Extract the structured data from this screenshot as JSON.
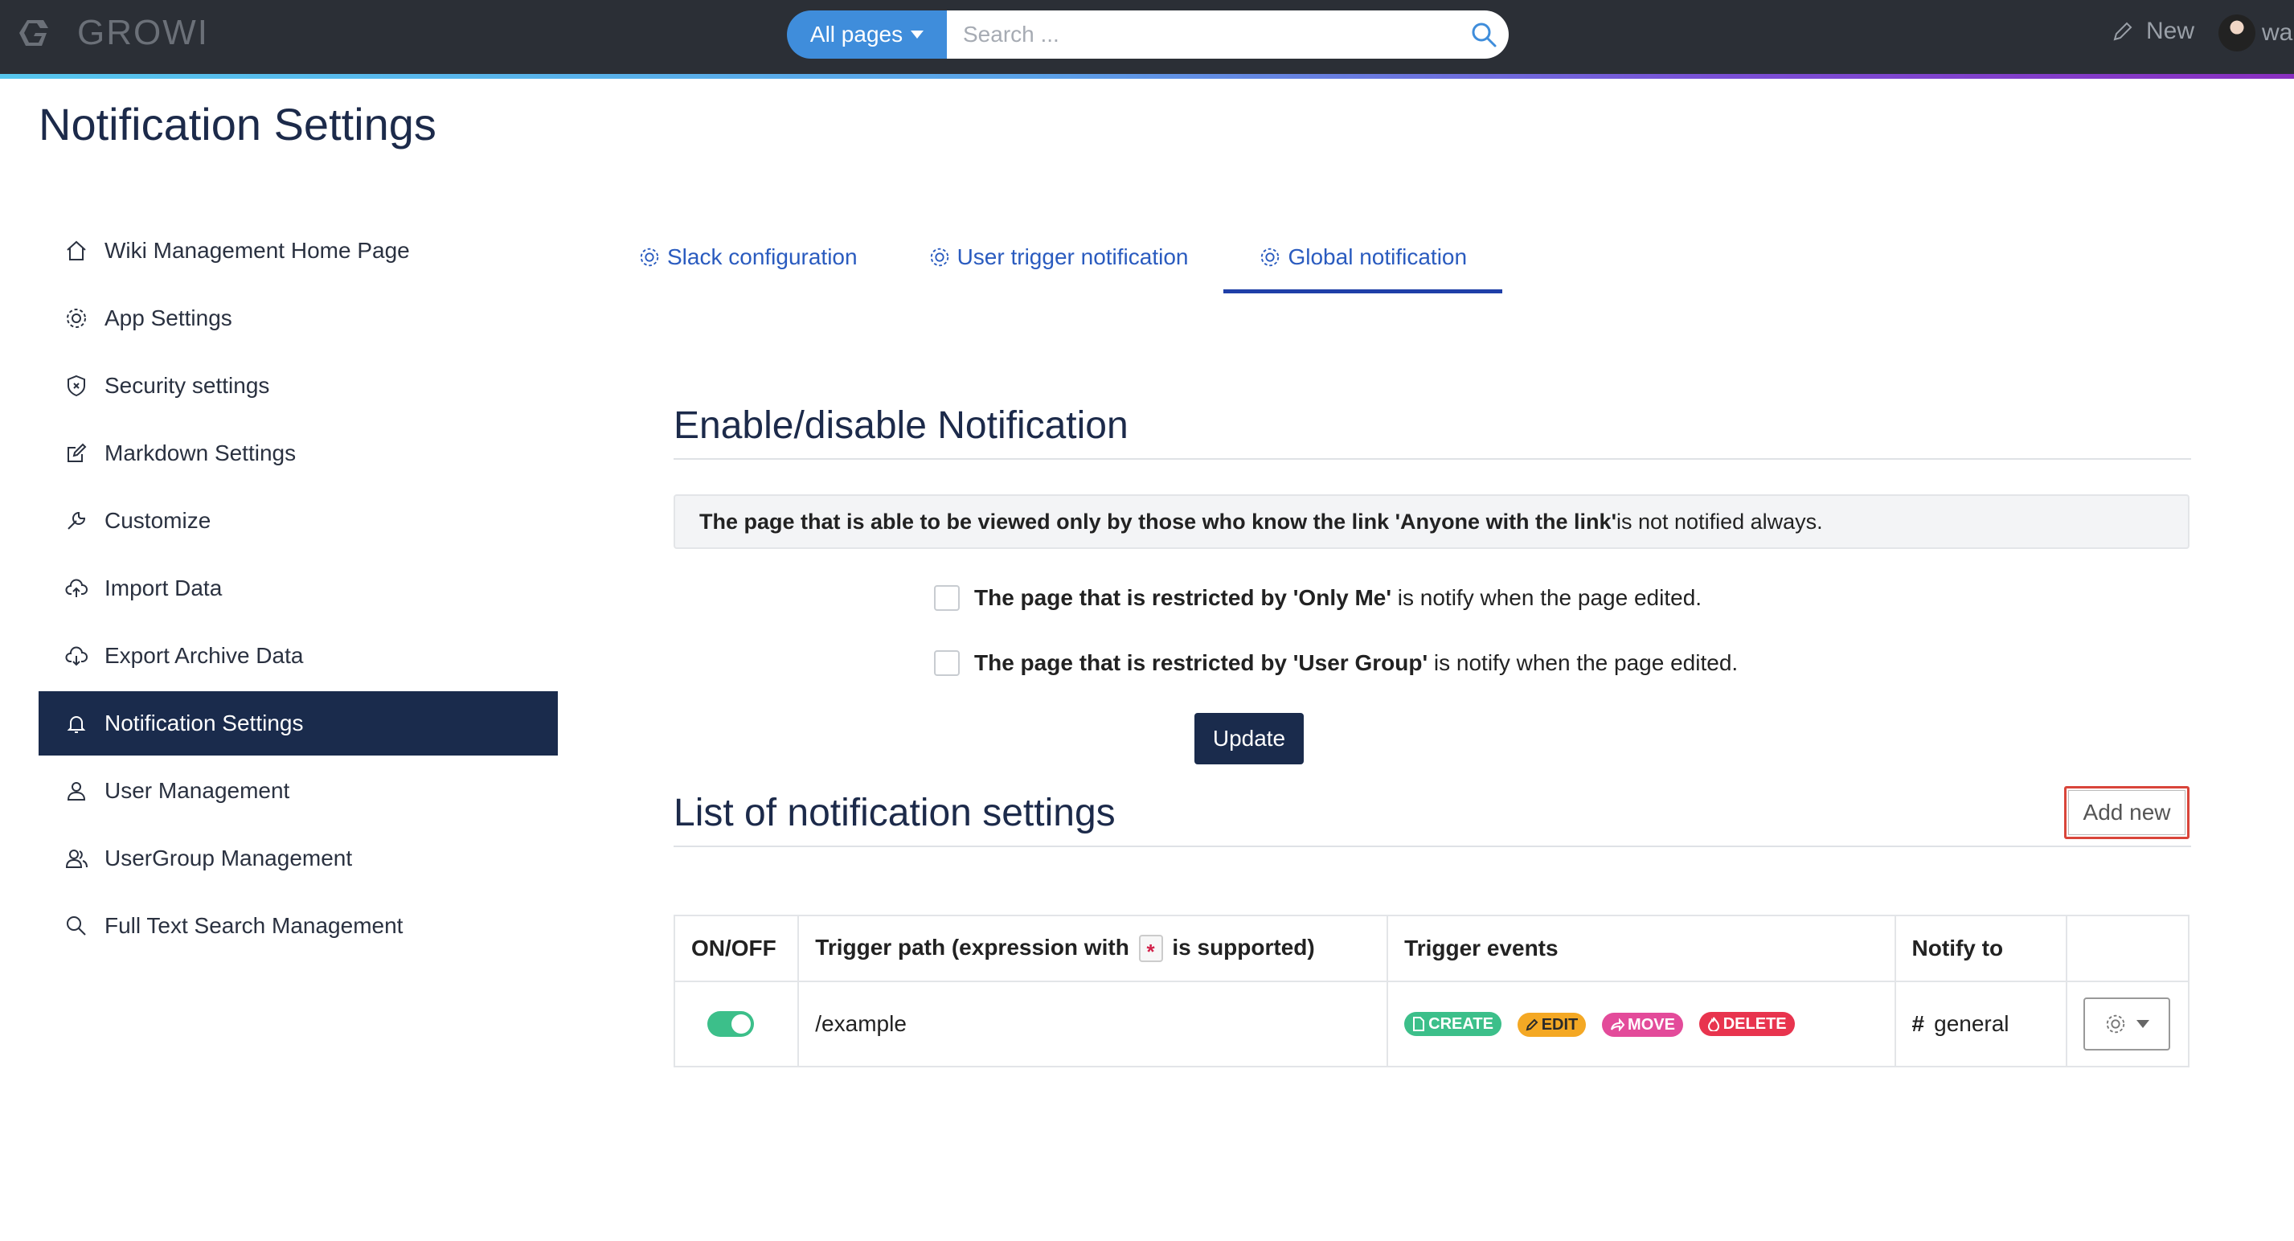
{
  "app": {
    "name": "GROWI"
  },
  "search": {
    "scope_label": "All pages",
    "placeholder": "Search ..."
  },
  "navbar": {
    "new_label": "New",
    "user_label": "wai"
  },
  "page": {
    "title": "Notification Settings"
  },
  "sidebar": {
    "items": [
      {
        "label": "Wiki Management Home Page",
        "icon": "home-icon"
      },
      {
        "label": "App Settings",
        "icon": "gear-icon"
      },
      {
        "label": "Security settings",
        "icon": "shield-icon"
      },
      {
        "label": "Markdown Settings",
        "icon": "edit-icon"
      },
      {
        "label": "Customize",
        "icon": "wrench-icon"
      },
      {
        "label": "Import Data",
        "icon": "cloud-upload-icon"
      },
      {
        "label": "Export Archive Data",
        "icon": "cloud-download-icon"
      },
      {
        "label": "Notification Settings",
        "icon": "bell-icon",
        "active": true
      },
      {
        "label": "User Management",
        "icon": "user-icon"
      },
      {
        "label": "UserGroup Management",
        "icon": "users-icon"
      },
      {
        "label": "Full Text Search Management",
        "icon": "search-icon"
      }
    ]
  },
  "tabs": [
    {
      "label": "Slack configuration"
    },
    {
      "label": "User trigger notification"
    },
    {
      "label": "Global notification",
      "active": true
    }
  ],
  "enable_section": {
    "heading": "Enable/disable Notification",
    "alert_bold": "The page that is able to be viewed only by those who know the link 'Anyone with the link'",
    "alert_rest": " is not notified always.",
    "options": [
      {
        "bold": "The page that is restricted by 'Only Me'",
        "rest": " is notify when the page edited.",
        "checked": false
      },
      {
        "bold": "The page that is restricted by 'User Group'",
        "rest": " is notify when the page edited.",
        "checked": false
      }
    ],
    "update_label": "Update"
  },
  "list_section": {
    "heading": "List of notification settings",
    "add_new_label": "Add new",
    "columns": {
      "onoff": "ON/OFF",
      "path_before": "Trigger path (expression with",
      "path_asterisk": "*",
      "path_after": "is supported)",
      "events": "Trigger events",
      "notify": "Notify to"
    },
    "rows": [
      {
        "enabled": true,
        "path": "/example",
        "events": [
          {
            "label": "CREATE",
            "color": "#3cbf8a",
            "icon": "file-icon"
          },
          {
            "label": "EDIT",
            "color": "#f4a824",
            "icon": "pencil-icon"
          },
          {
            "label": "MOVE",
            "color": "#e34b9a",
            "icon": "share-icon"
          },
          {
            "label": "DELETE",
            "color": "#e8344e",
            "icon": "fire-icon"
          }
        ],
        "notify_symbol": "#",
        "notify_to": "general"
      }
    ]
  },
  "colors": {
    "navbar": "#2b2f36",
    "accent_blue": "#3f8ddb",
    "sidebar_active": "#1a2b4c",
    "tab_link": "#2a5bbf",
    "toggle_on": "#3cbf8a"
  }
}
